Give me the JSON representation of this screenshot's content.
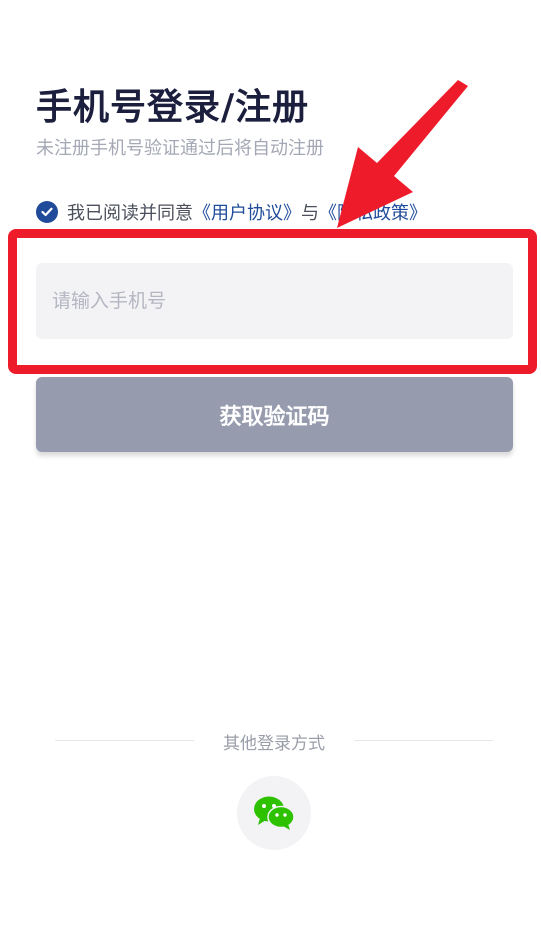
{
  "header": {
    "title": "手机号登录/注册",
    "subtitle": "未注册手机号验证通过后将自动注册"
  },
  "agreement": {
    "prefix": "我已阅读并同意",
    "user_agreement": "《用户协议》",
    "conjunction": "与",
    "privacy_policy": "《隐私政策》",
    "checked": true
  },
  "phone": {
    "placeholder": "请输入手机号",
    "value": ""
  },
  "get_code_button": {
    "label": "获取验证码"
  },
  "other_login": {
    "label": "其他登录方式",
    "methods": [
      "wechat-icon"
    ]
  },
  "colors": {
    "accent": "#1f4b9a",
    "title": "#1b1e3d",
    "button_disabled": "#979bae",
    "annotation_red": "#ee1c2b",
    "wechat_green": "#2dc100"
  }
}
